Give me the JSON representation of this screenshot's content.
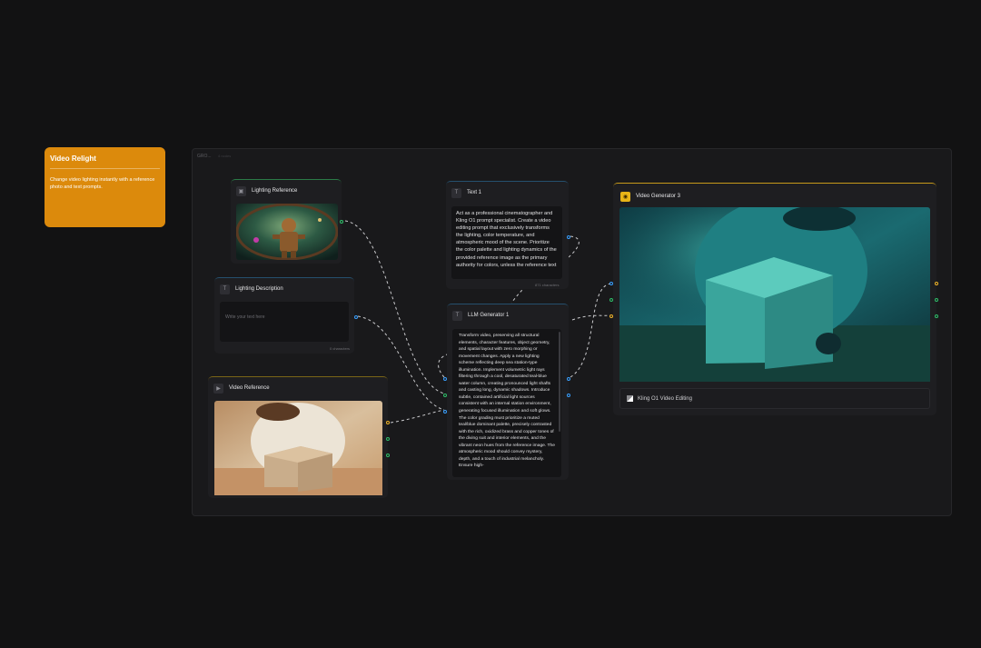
{
  "info_card": {
    "title": "Video Relight",
    "description": "Change video lighting instantly with a reference photo and text prompts."
  },
  "group": {
    "label": "GRO...",
    "sublabel": "4 nodes"
  },
  "nodes": {
    "lighting_reference": {
      "title": "Lighting Reference",
      "icon": "image-icon"
    },
    "lighting_description": {
      "title": "Lighting Description",
      "placeholder": "Write your text here",
      "counter": "0 characters",
      "icon": "text-icon"
    },
    "video_reference": {
      "title": "Video Reference",
      "icon": "video-icon"
    },
    "text_1": {
      "title": "Text 1",
      "icon": "text-icon",
      "body": "Act as a professional cinematographer and Kling O1 prompt specialist. Create a video editing prompt that exclusively transforms the lighting, color temperature, and atmospheric mood of the scene. Prioritize the color palette and lighting dynamics of the provided reference image as the primary authority for colors, unless the reference text",
      "counter": "871 characters"
    },
    "llm_generator": {
      "title": "LLM Generator 1",
      "icon": "text-icon",
      "body": "Transform video, preserving all structural elements, character features, object geometry, and spatial layout with zero morphing or movement changes. Apply a new lighting scheme reflecting deep sea station-type illumination. Implement volumetric light rays filtering through a cool, desaturated teal-blue water column, creating pronounced light shafts and casting long, dynamic shadows. Introduce subtle, contained artificial light sources consistent with an internal station environment, generating focused illumination and soft glows. The color grading must prioritize a muted teal/blue dominant palette, precisely contrasted with the rich, oxidized brass and copper tones of the diving suit and interior elements, and the vibrant neon hues from the reference image. The atmospheric mood should convey mystery, depth, and a touch of industrial melancholy. Ensure high-"
    },
    "video_generator": {
      "title": "Video Generator 3",
      "icon": "video-generator-icon",
      "model_label": "Kling O1 Video Editing",
      "model_icon": "kling-logo-icon"
    }
  },
  "colors": {
    "card_orange": "#dc8a0c",
    "port_blue": "#3aa0ff",
    "port_green": "#2fbf6a",
    "port_orange": "#f0b429",
    "node_yellow": "#e8b417"
  }
}
